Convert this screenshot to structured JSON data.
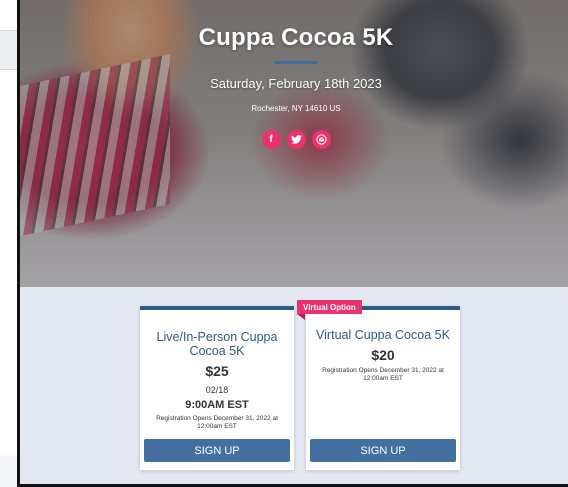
{
  "event": {
    "title": "Cuppa Cocoa 5K",
    "date": "Saturday, February 18th 2023",
    "location": "Rochester, NY 14610 US"
  },
  "share": {
    "facebook_glyph": "f",
    "icons": [
      "facebook-icon",
      "twitter-icon",
      "email-icon"
    ],
    "accent_color": "#e8336f"
  },
  "options": [
    {
      "title": "Live/In-Person Cuppa Cocoa 5K",
      "price": "$25",
      "date": "02/18",
      "time": "9:00AM EST",
      "registration": "Registration Opens December 31, 2022 at 12:00am EST",
      "button": "SIGN UP"
    },
    {
      "badge": "Virtual Option",
      "title": "Virtual Cuppa Cocoa 5K",
      "price": "$20",
      "registration": "Registration Opens December 31, 2022 at 12:00am EST",
      "button": "SIGN UP"
    }
  ],
  "colors": {
    "primary": "#2f5a83",
    "button": "#4470a0",
    "badge": "#e8336f",
    "section_bg": "#e4e8f1"
  }
}
